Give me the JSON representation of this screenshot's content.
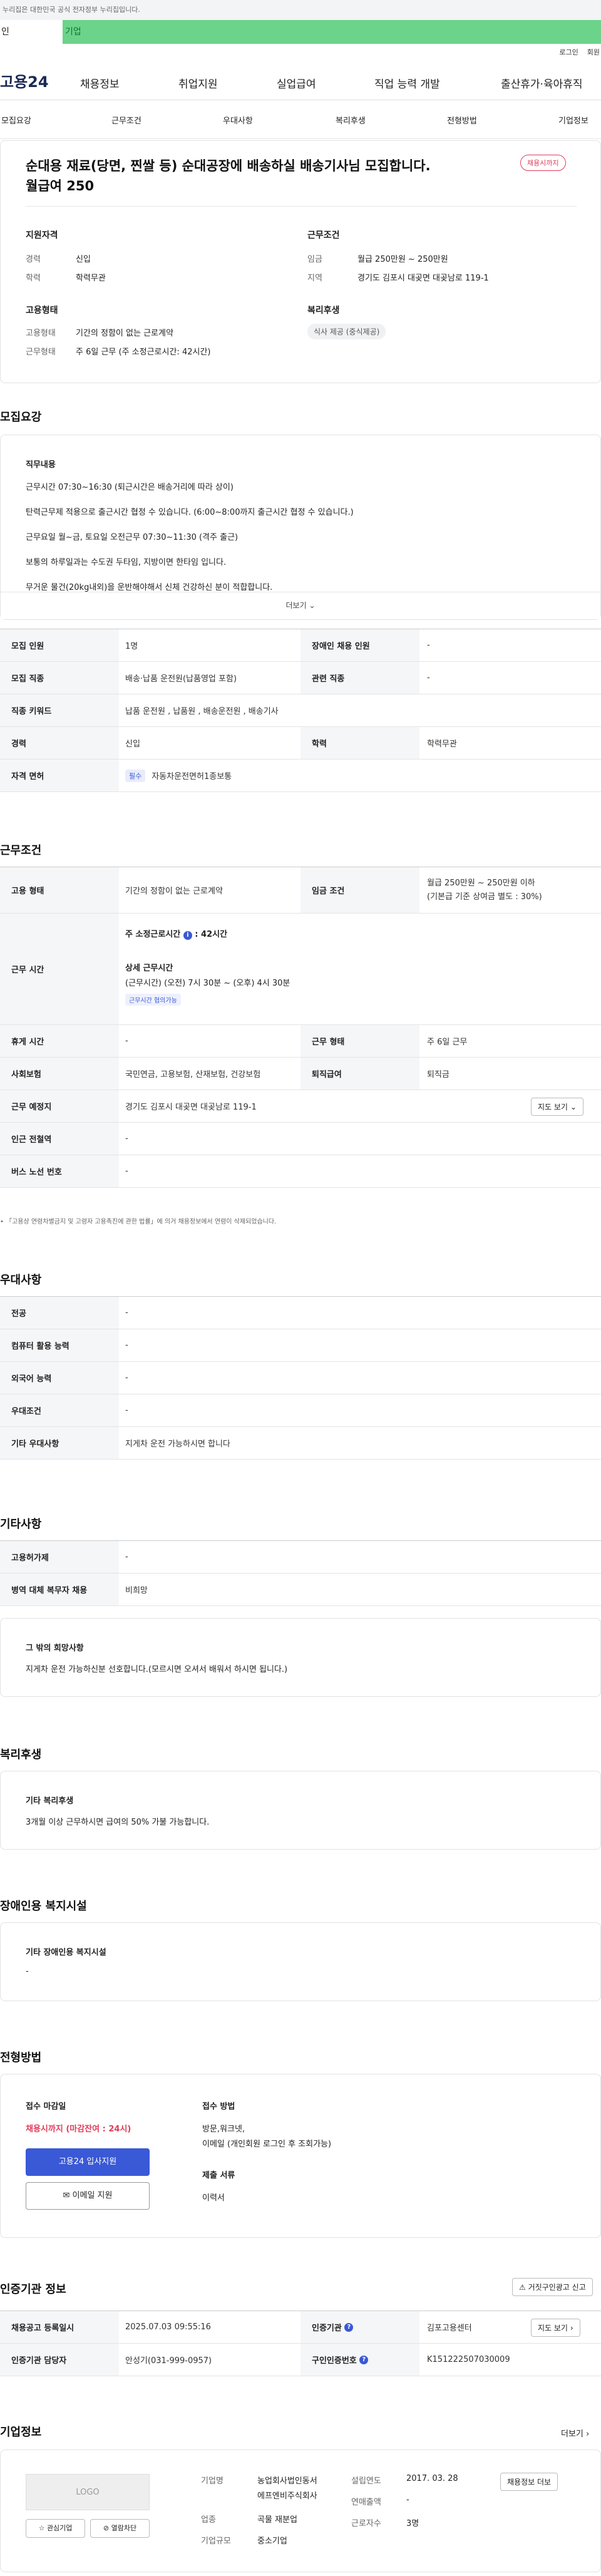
{
  "gov_notice": "누리집은 대한민국 공식 전자정부 누리집입니다.",
  "service_tabs": [
    "인",
    "기업"
  ],
  "util": [
    "로그인",
    "회원"
  ],
  "logo": "고용24",
  "gnb": [
    "채용정보",
    "취업지원",
    "실업급여",
    "직업 능력 개발",
    "출산휴가·육아휴직"
  ],
  "subnav": [
    "모집요강",
    "근무조건",
    "우대사항",
    "복리후생",
    "전형방법",
    "기업정보"
  ],
  "job": {
    "title_line1": "순대용 재료(당면, 찐쌀 등) 순대공장에 배송하실 배송기사님 모집합니다.",
    "title_line2": "월급여 250",
    "status_badge": "채용시까지",
    "qual_title": "지원자격",
    "career_label": "경력",
    "career": "신입",
    "edu_label": "학력",
    "edu": "학력무관",
    "cond_title": "근무조건",
    "wage_label": "임금",
    "wage": "월급 250만원 ~ 250만원",
    "region_label": "지역",
    "region": "경기도 김포시 대곶면 대곶남로 119-1",
    "form_title": "고용형태",
    "emp_label": "고용형태",
    "emp": "기간의 정함이 없는 근로계약",
    "work_label": "근무형태",
    "work": "주 6일 근무 (주 소정근로시간: 42시간)",
    "welfare_title": "복리후생",
    "welfare_chip": "식사 제공 (중식제공)"
  },
  "recruit": {
    "title": "모집요강",
    "duty_title": "직무내용",
    "duty_lines": [
      "근무시간 07:30~16:30 (퇴근시간은 배송거리에 따라 상이)",
      "탄력근무제 적용으로 출근시간 협정 수 있습니다. (6:00~8:00까지 출근시간 협정 수 있습니다.)",
      "근무요일 월~금, 토요일 오전근무 07:30~11:30 (격주 출근)",
      "보통의 하루일과는 수도권 두타임, 지방이면 한타임 입니다.",
      "무거운 물건(20kg내외)을 운반해야해서 신체 건강하신 분이 적합합니다."
    ],
    "more": "더보기",
    "rows": [
      {
        "k1": "모집 인원",
        "v1": "1명",
        "k2": "장애인 채용 인원",
        "v2": "-"
      },
      {
        "k1": "모집 직종",
        "v1": "배송·납품 운전원(납품영업 포함)",
        "k2": "관련 직종",
        "v2": "-"
      },
      {
        "k1": "직종 키워드",
        "v1": "납품 운전원 , 납품원 , 배송운전원 , 배송기사",
        "k2": "",
        "v2": ""
      },
      {
        "k1": "경력",
        "v1": "신입",
        "k2": "학력",
        "v2": "학력무관"
      }
    ],
    "license_label": "자격 면허",
    "license_badge": "필수",
    "license": "자동차운전면허1종보통"
  },
  "cond": {
    "title": "근무조건",
    "emp_k": "고용 형태",
    "emp_v": "기간의 정함이 없는 근로계약",
    "wage_k": "임금 조건",
    "wage_v1": "월급 250만원 ~ 250만원 이하",
    "wage_v2": "(기본급 기준 상여금 별도 : 30%)",
    "hours_k": "근무 시간",
    "hours_week": "주 소정근로시간",
    "hours_week_v": "42시간",
    "hours_detail_t": "상세 근무시간",
    "hours_detail": "(근무시간) (오전) 7시 30분 ~ (오후) 4시 30분",
    "flex_badge": "근무시간 협의가능",
    "rest_k": "휴게 시간",
    "rest_v": "-",
    "form_k": "근무 형태",
    "form_v": "주 6일 근무",
    "ins_k": "사회보험",
    "ins_v": "국민연금, 고용보험, 산재보험, 건강보험",
    "ret_k": "퇴직급여",
    "ret_v": "퇴직금",
    "place_k": "근무 예정지",
    "place_v": "경기도 김포시 대곶면 대곶남로 119-1",
    "map_btn": "지도 보기",
    "subway_k": "인근 전철역",
    "subway_v": "-",
    "bus_k": "버스 노선 번호",
    "bus_v": "-",
    "note": "「고용상 연령차별금지 및 고령자 고용촉진에 관한 법률」에 의거 채용정보에서 연령이 삭제되었습니다."
  },
  "pref": {
    "title": "우대사항",
    "rows": [
      {
        "k": "전공",
        "v": "-"
      },
      {
        "k": "컴퓨터 활용 능력",
        "v": "-"
      },
      {
        "k": "외국어 능력",
        "v": "-"
      },
      {
        "k": "우대조건",
        "v": "-"
      },
      {
        "k": "기타 우대사항",
        "v": "지게차 운전 가능하시면 합니다"
      }
    ]
  },
  "etc": {
    "title": "기타사항",
    "rows": [
      {
        "k": "고용허가제",
        "v": "-"
      },
      {
        "k": "병역 대체 복무자 채용",
        "v": "비희망"
      }
    ],
    "wish_t": "그 밖의 희망사항",
    "wish_v": "지게차 운전 가능하신분 선호합니다.(모르시면 오셔서 배워서 하시면 됩니다.)"
  },
  "welfare": {
    "title": "복리후생",
    "t": "기타 복리후생",
    "v": "3개월 이상 근무하시면 급여의 50% 가불 가능합니다."
  },
  "disab": {
    "title": "장애인용 복지시설",
    "t": "기타 장애인용 복지시설",
    "v": "-"
  },
  "apply": {
    "title": "전형방법",
    "deadline_t": "접수 마감일",
    "deadline_v": "채용시까지 (마감잔여 : 24시)",
    "btn_apply": "고용24 입사지원",
    "btn_email": "이메일 지원",
    "method_t": "접수 방법",
    "method_v1": "방문,워크넷,",
    "method_v2": "이메일 (개인회원 로그인 후 조회가능)",
    "docs_t": "제출 서류",
    "docs_v": "이력서"
  },
  "agency": {
    "title": "인증기관 정보",
    "report_btn": "거짓구인광고 신고",
    "r1k1": "채용공고 등록일시",
    "r1v1": "2025.07.03 09:55:16",
    "r1k2": "인증기관",
    "r1v2": "김포고용센터",
    "r1btn": "지도 보기",
    "r2k1": "인증기관 담당자",
    "r2v1": "안성기(031-999-0957)",
    "r2k2": "구인인증번호",
    "r2v2": "K151222507030009"
  },
  "company": {
    "title": "기업정보",
    "more": "더보기",
    "logo": "LOGO",
    "fav": "관심기업",
    "block": "열람차단",
    "name_k": "기업명",
    "name_v1": "농업회사법인동서",
    "name_v2": "에프엔비주식회사",
    "ind_k": "업종",
    "ind_v": "곡물 재분업",
    "size_k": "기업규모",
    "size_v": "중소기업",
    "est_k": "설립연도",
    "est_v": "2017. 03. 28",
    "sales_k": "연매출액",
    "sales_v": "-",
    "emp_k": "근로자수",
    "emp_v": "3명",
    "jobs_btn": "채용정보 더보"
  },
  "colors": {
    "accent": "#1b2a55",
    "green": "#6bd38a",
    "red": "#e03c5a",
    "blue": "#3a59d6"
  }
}
